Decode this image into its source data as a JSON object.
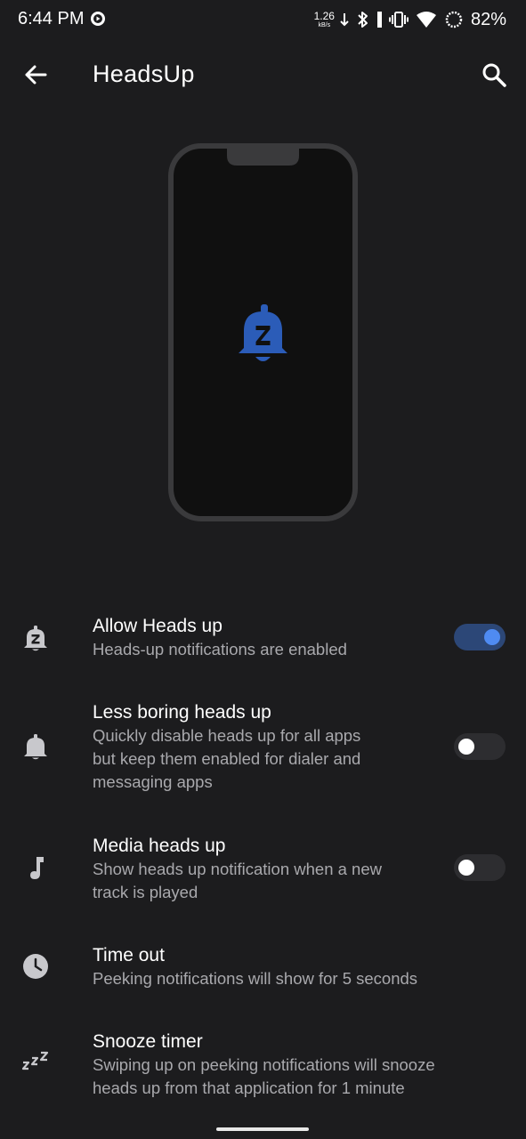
{
  "status_bar": {
    "time": "6:44 PM",
    "net_speed_value": "1.26",
    "net_speed_unit": "kB/s",
    "battery": "82%",
    "icons": [
      "media-icon",
      "download-arrow-icon",
      "bluetooth-icon",
      "vibrate-icon",
      "wifi-icon",
      "battery-icon"
    ]
  },
  "app_bar": {
    "title": "HeadsUp",
    "back_icon": "arrow-back-icon",
    "search_icon": "search-icon"
  },
  "colors": {
    "background": "#1c1c1e",
    "accent": "#4f8bf2",
    "accent_track": "#2c4777",
    "bell_blue": "#2b5cb8",
    "summary_text": "#a9a9ad"
  },
  "settings": [
    {
      "title": "Allow Heads up",
      "summary": "Heads-up notifications are enabled",
      "icon": "bell-snooze-icon",
      "toggle": true
    },
    {
      "title": "Less boring heads up",
      "summary_lines": [
        "Quickly disable heads up for all apps",
        "but keep them enabled for dialer and",
        "messaging apps"
      ],
      "icon": "bell-icon",
      "toggle": false
    },
    {
      "title": "Media heads up",
      "summary_lines": [
        "Show heads up notification when a new",
        "track is played"
      ],
      "icon": "music-note-icon",
      "toggle": false
    },
    {
      "title": "Time out",
      "summary": "Peeking notifications will show for 5 seconds",
      "icon": "clock-icon"
    },
    {
      "title": "Snooze timer",
      "summary_lines": [
        "Swiping up on peeking notifications will snooze",
        "heads up from that application for 1 minute"
      ],
      "icon": "zzz-icon"
    }
  ]
}
